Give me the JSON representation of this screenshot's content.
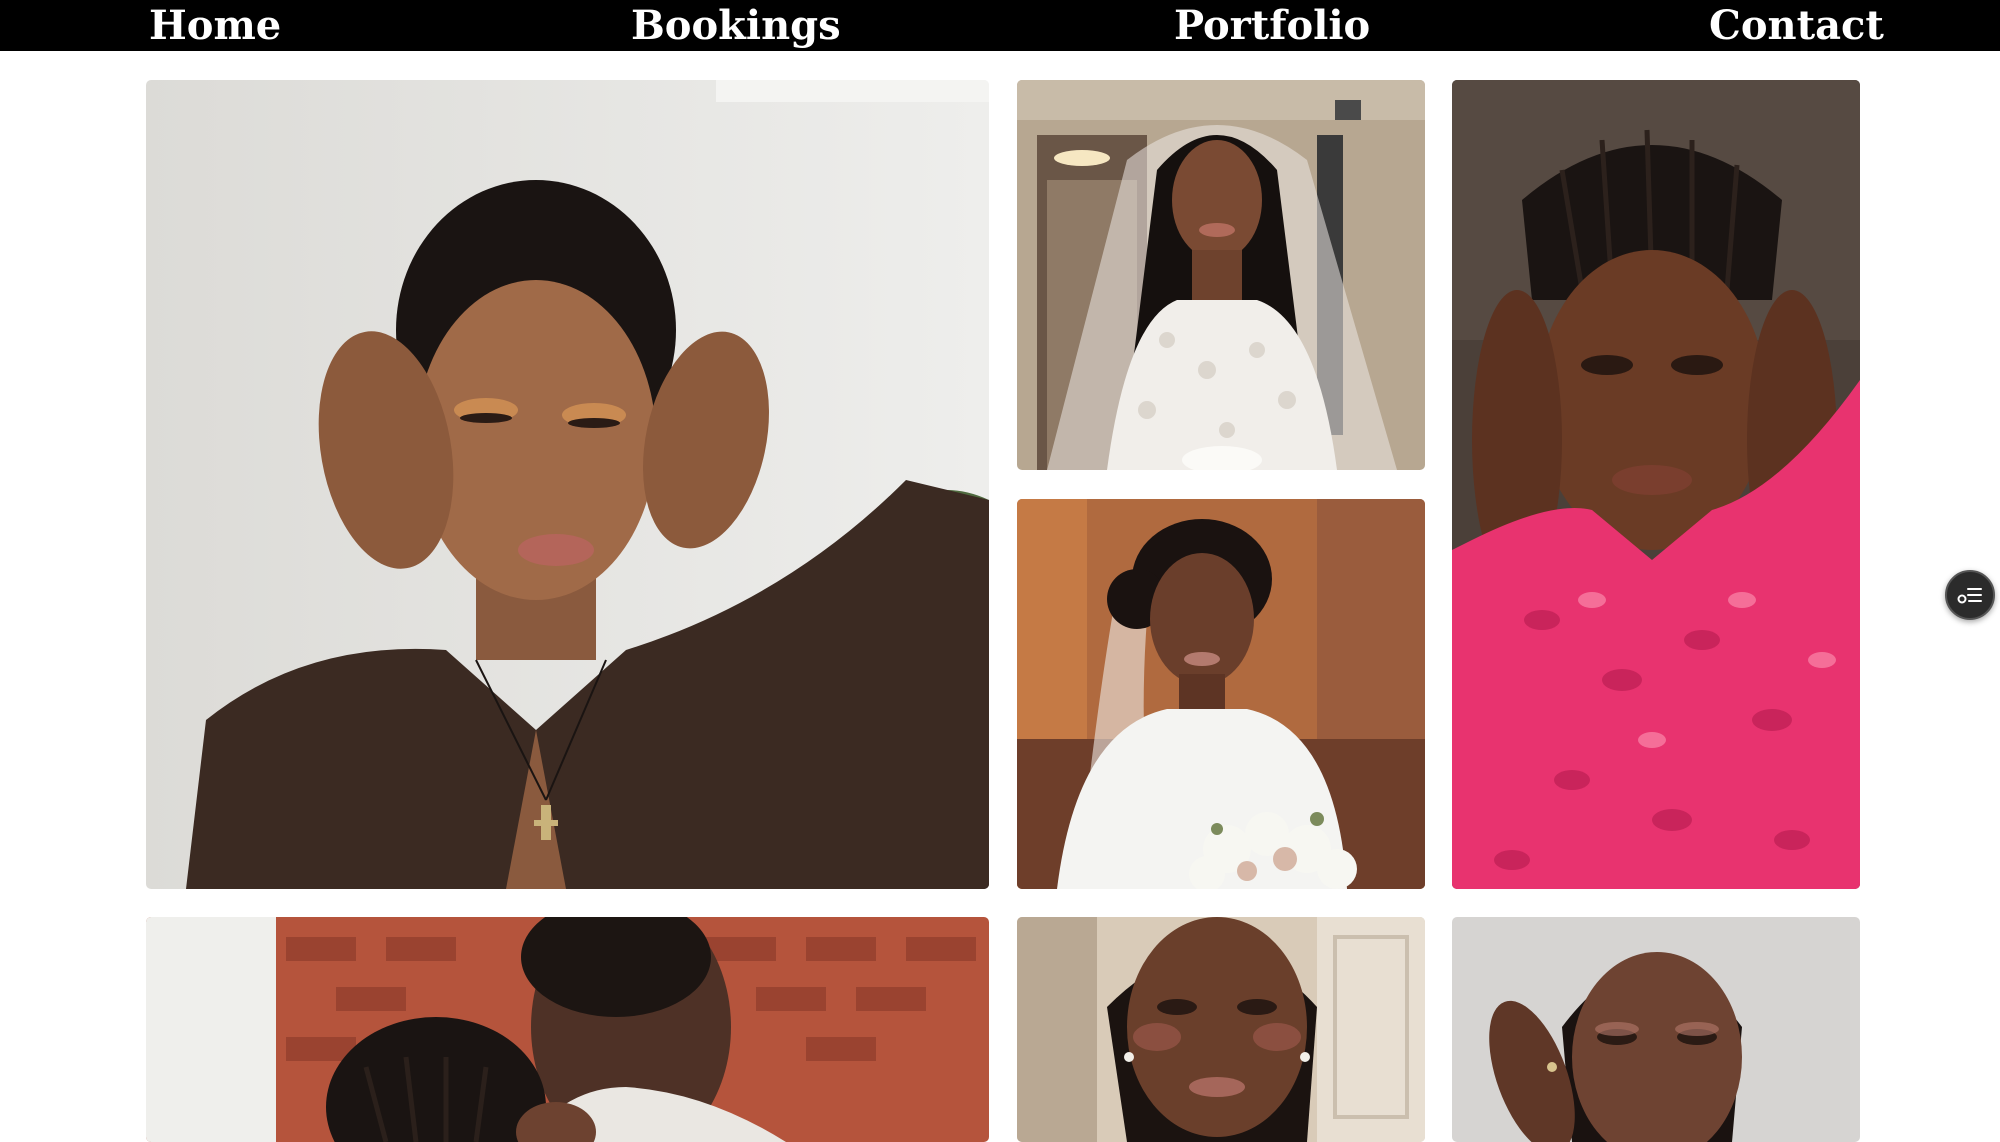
{
  "nav": {
    "home": "Home",
    "bookings": "Bookings",
    "portfolio": "Portfolio",
    "contact": "Contact"
  },
  "gallery": {
    "tiles": [
      {
        "subject": "woman-brown-blouse-shimmer-eyeshadow",
        "background": "#e4e3e0",
        "accent": "#3b2a22"
      },
      {
        "subject": "bride-lace-gown-veil",
        "background": "#b7a791",
        "accent": "#f1eeea"
      },
      {
        "subject": "bride-white-dress-bouquet",
        "background": "#b06a3f",
        "accent": "#f4f4f2"
      },
      {
        "subject": "woman-pink-ruffle-top-braids",
        "background": "#4b4039",
        "accent": "#e8336f"
      },
      {
        "subject": "couple-brick-wall",
        "background": "#b5543c",
        "accent": "#4e3126"
      },
      {
        "subject": "bride-cream-door",
        "background": "#d9cbb8",
        "accent": "#5a3627"
      },
      {
        "subject": "woman-grey-backdrop",
        "background": "#d6d4d2",
        "accent": "#6e4332"
      }
    ]
  },
  "fab": {
    "icon": "menu-list-icon"
  }
}
